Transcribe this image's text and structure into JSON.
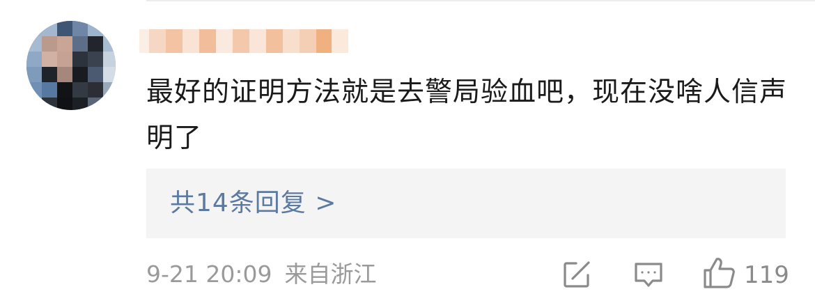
{
  "comment": {
    "text": "最好的证明方法就是去警局验血吧，现在没啥人信声明了",
    "replies_label": "共14条回复 >",
    "time": "9-21 20:09",
    "location": "来自浙江",
    "like_count": "119"
  },
  "icons": {
    "share": "share-icon",
    "reply": "comment-icon",
    "like": "thumbs-up-icon"
  },
  "colors": {
    "text": "#1a1a1a",
    "link": "#5c7aa0",
    "meta": "#9a9a9a",
    "reply_box_bg": "#f4f4f4",
    "icon": "#8a8a8a"
  }
}
